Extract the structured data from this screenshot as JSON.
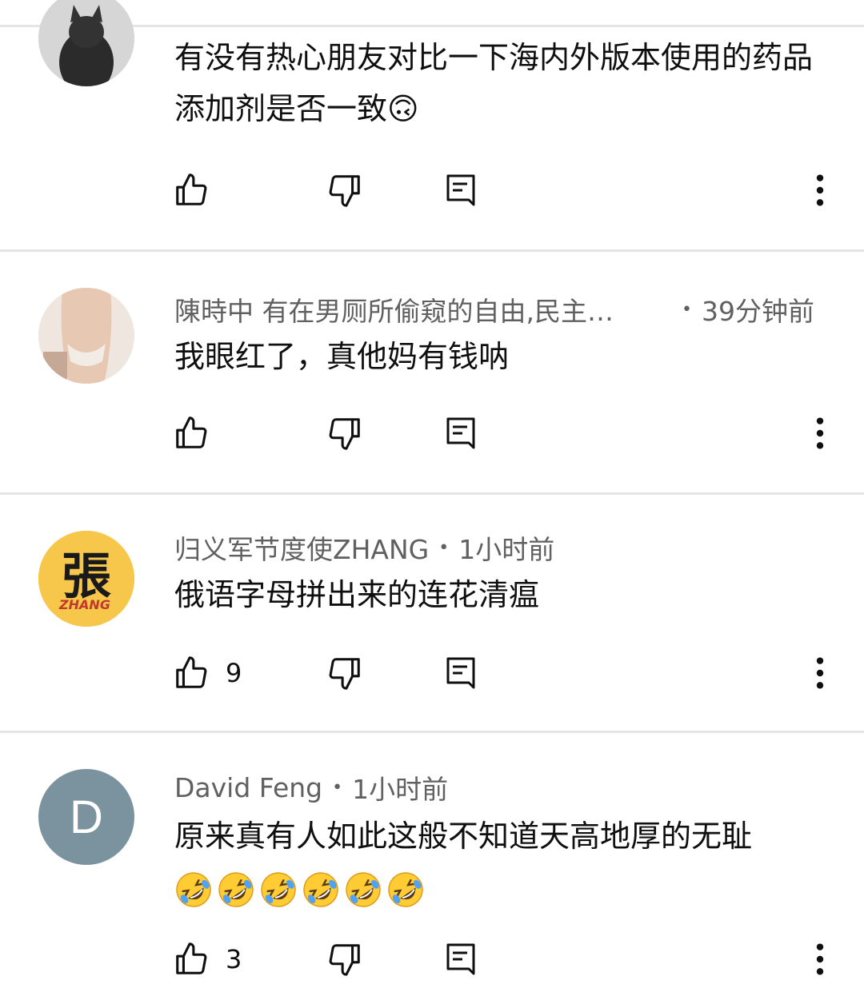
{
  "comments": [
    {
      "author": "",
      "time": "",
      "text": "有没有热心朋友对比一下海内外版本使用的药品添加剂是否一致🙃",
      "likes": "",
      "avatar": "black-cat-avatar"
    },
    {
      "author": "陳時中 有在男厕所偷窥的自由,民主…",
      "separator": "•",
      "time": "39分钟前",
      "text": "我眼红了，真他妈有钱呐",
      "likes": "",
      "avatar": "photo-avatar"
    },
    {
      "author": "归义军节度使ZHANG",
      "separator": "•",
      "time": "1小时前",
      "text": "俄语字母拼出来的连花清瘟",
      "likes": "9",
      "avatar": "calligraphy-avatar",
      "avatar_glyph": "張",
      "avatar_sub": "ZHANG"
    },
    {
      "author": "David Feng",
      "separator": "•",
      "time": "1小时前",
      "text": "原来真有人如此这般不知道天高地厚的无耻",
      "likes": "3",
      "avatar": "letter-avatar",
      "avatar_letter": "D",
      "emoji_count": 6
    }
  ],
  "colors": {
    "divider": "#e5e5e5",
    "meta_text": "#606060",
    "avatar_letter_bg": "#7b939f",
    "avatar_zhang_bg": "#f6c74a"
  }
}
